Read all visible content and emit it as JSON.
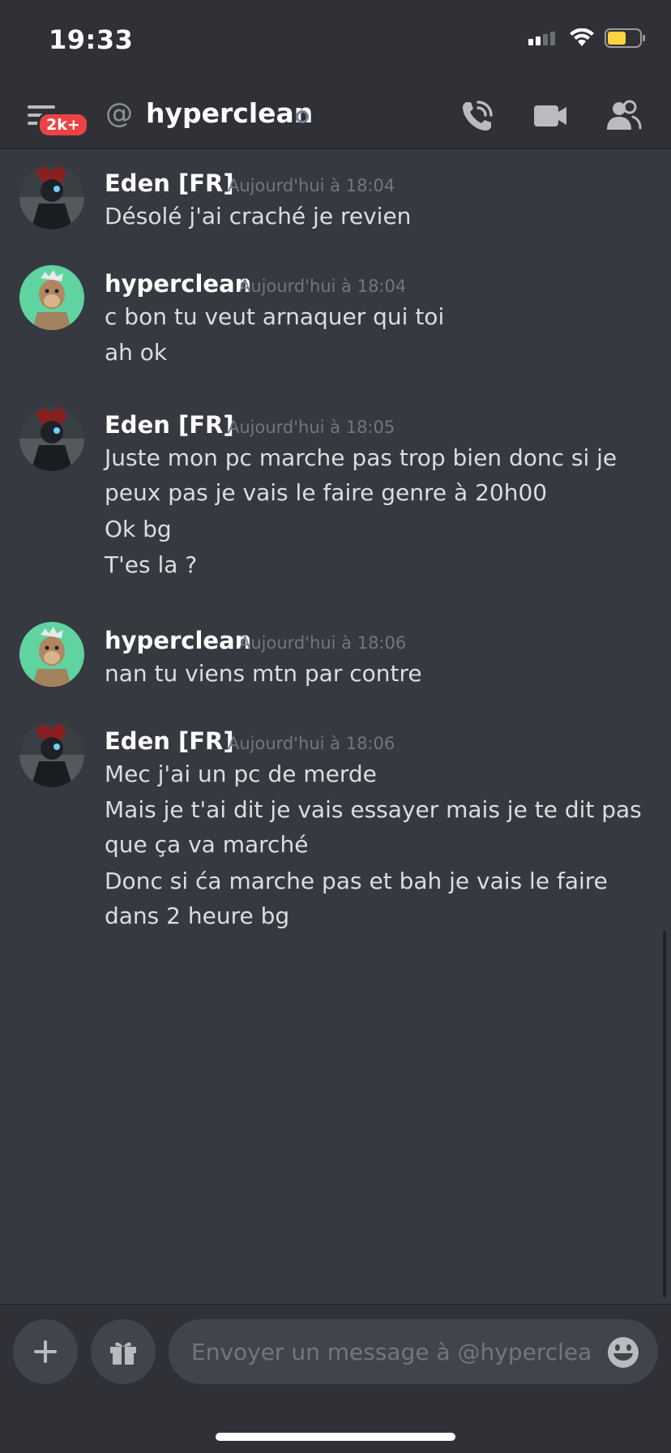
{
  "status_bar": {
    "time": "19:33"
  },
  "header": {
    "badge": "2k+",
    "at_symbol": "@",
    "title": "hyperclean"
  },
  "messages": [
    {
      "author": "Eden [FR]",
      "timestamp": "Aujourd'hui à 18:04",
      "lines": [
        "Désolé j'ai craché je revien"
      ]
    },
    {
      "author": "hyperclean",
      "timestamp": "Aujourd'hui à 18:04",
      "lines": [
        "c bon tu veut arnaquer qui toi",
        "ah ok"
      ]
    },
    {
      "author": "Eden [FR]",
      "timestamp": "Aujourd'hui à 18:05",
      "lines": [
        "Juste mon pc marche pas trop bien donc si je peux pas je vais le faire genre à 20h00",
        "Ok bg",
        "T'es la ?"
      ]
    },
    {
      "author": "hyperclean",
      "timestamp": "Aujourd'hui à 18:06",
      "lines": [
        "nan tu viens mtn par contre"
      ]
    },
    {
      "author": "Eden [FR]",
      "timestamp": "Aujourd'hui à 18:06",
      "lines": [
        "Mec j'ai un pc de merde",
        "Mais je t'ai dit je vais essayer mais je te dit pas que ça va marché",
        "Donc si ća marche pas et bah je vais le faire dans 2 heure bg"
      ]
    }
  ],
  "composer": {
    "placeholder": "Envoyer un message à @hyperclean"
  },
  "icons": {
    "menu": "menu-icon",
    "call": "phone-call-icon",
    "video": "video-camera-icon",
    "members": "members-icon",
    "add": "plus-icon",
    "gift": "gift-icon",
    "emoji": "emoji-icon"
  },
  "colors": {
    "background": "#36393f",
    "header": "#2f3136",
    "badge": "#ed4245",
    "input": "#40444b",
    "avatar_hyperclean": "#5fd3a0"
  }
}
